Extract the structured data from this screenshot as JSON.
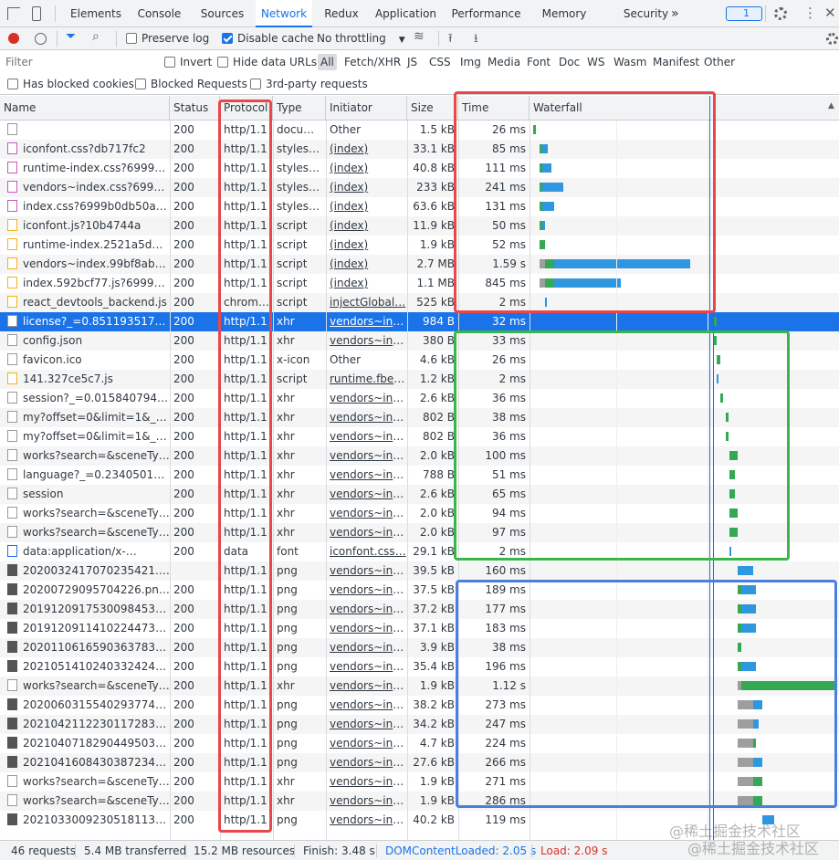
{
  "tabs": [
    "Elements",
    "Console",
    "Sources",
    "Network",
    "Redux",
    "Application",
    "Performance",
    "Memory",
    "Security"
  ],
  "tabs_more": "»",
  "issues_count": "1",
  "toolbar": {
    "preserve_log": "Preserve log",
    "disable_cache": "Disable cache",
    "throttling": "No throttling"
  },
  "filter": {
    "placeholder": "Filter",
    "invert": "Invert",
    "hide_data_urls": "Hide data URLs",
    "types": [
      "All",
      "Fetch/XHR",
      "JS",
      "CSS",
      "Img",
      "Media",
      "Font",
      "Doc",
      "WS",
      "Wasm",
      "Manifest",
      "Other"
    ]
  },
  "filter2": {
    "blocked_cookies": "Has blocked cookies",
    "blocked_requests": "Blocked Requests",
    "third_party": "3rd-party requests"
  },
  "columns": {
    "name": "Name",
    "status": "Status",
    "protocol": "Protocol",
    "type": "Type",
    "initiator": "Initiator",
    "size": "Size",
    "time": "Time",
    "waterfall": "Waterfall"
  },
  "colors": {
    "accent": "#1a73e8",
    "red_box": "#e8474b",
    "green_box": "#3ab54a",
    "blue_box": "#4a7fe0",
    "wf_blue": "#2f96e0",
    "wf_green": "#34a853",
    "wf_gray": "#9e9e9e"
  },
  "rows": [
    {
      "name": "",
      "icon": "doc",
      "status": "200",
      "protocol": "http/1.1",
      "type": "docu…",
      "initiator": "Other",
      "size": "1.5 kB",
      "time": "26 ms",
      "wf": [
        [
          0.0,
          0.01,
          "green"
        ]
      ]
    },
    {
      "name": "iconfont.css?db717fc2",
      "icon": "css",
      "status": "200",
      "protocol": "http/1.1",
      "type": "styles…",
      "initiator": "(index)",
      "size": "33.1 kB",
      "time": "85 ms",
      "wf": [
        [
          0.02,
          0.01,
          "green"
        ],
        [
          0.03,
          0.02,
          "blue"
        ]
      ]
    },
    {
      "name": "runtime-index.css?6999b0…",
      "icon": "css",
      "status": "200",
      "protocol": "http/1.1",
      "type": "styles…",
      "initiator": "(index)",
      "size": "40.8 kB",
      "time": "111 ms",
      "wf": [
        [
          0.02,
          0.01,
          "green"
        ],
        [
          0.03,
          0.03,
          "blue"
        ]
      ]
    },
    {
      "name": "vendors~index.css?6999b…",
      "icon": "css",
      "status": "200",
      "protocol": "http/1.1",
      "type": "styles…",
      "initiator": "(index)",
      "size": "233 kB",
      "time": "241 ms",
      "wf": [
        [
          0.02,
          0.01,
          "green"
        ],
        [
          0.03,
          0.07,
          "blue"
        ]
      ]
    },
    {
      "name": "index.css?6999b0db50a9…",
      "icon": "css",
      "status": "200",
      "protocol": "http/1.1",
      "type": "styles…",
      "initiator": "(index)",
      "size": "63.6 kB",
      "time": "131 ms",
      "wf": [
        [
          0.02,
          0.01,
          "green"
        ],
        [
          0.03,
          0.04,
          "blue"
        ]
      ]
    },
    {
      "name": "iconfont.js?10b4744a",
      "icon": "js",
      "status": "200",
      "protocol": "http/1.1",
      "type": "script",
      "initiator": "(index)",
      "size": "11.9 kB",
      "time": "50 ms",
      "wf": [
        [
          0.02,
          0.01,
          "green"
        ],
        [
          0.03,
          0.01,
          "blue"
        ]
      ]
    },
    {
      "name": "runtime-index.2521a5d8.js…",
      "icon": "js",
      "status": "200",
      "protocol": "http/1.1",
      "type": "script",
      "initiator": "(index)",
      "size": "1.9 kB",
      "time": "52 ms",
      "wf": [
        [
          0.02,
          0.02,
          "green"
        ]
      ]
    },
    {
      "name": "vendors~index.99bf8abe.j…",
      "icon": "js",
      "status": "200",
      "protocol": "http/1.1",
      "type": "script",
      "initiator": "(index)",
      "size": "2.7 MB",
      "time": "1.59 s",
      "wf": [
        [
          0.02,
          0.02,
          "gray"
        ],
        [
          0.04,
          0.03,
          "green"
        ],
        [
          0.07,
          0.45,
          "blue"
        ]
      ]
    },
    {
      "name": "index.592bcf77.js?6999b0…",
      "icon": "js",
      "status": "200",
      "protocol": "http/1.1",
      "type": "script",
      "initiator": "(index)",
      "size": "1.1 MB",
      "time": "845 ms",
      "wf": [
        [
          0.02,
          0.02,
          "gray"
        ],
        [
          0.04,
          0.03,
          "green"
        ],
        [
          0.07,
          0.22,
          "blue"
        ]
      ]
    },
    {
      "name": "react_devtools_backend.js",
      "icon": "js",
      "status": "200",
      "protocol": "chrom…",
      "type": "script",
      "initiator": "injectGlobal…",
      "size": "525 kB",
      "time": "2 ms",
      "wf": [
        [
          0.04,
          0.005,
          "blue"
        ]
      ]
    },
    {
      "name": "license?_=0.85119351779…",
      "icon": "doc",
      "status": "200",
      "protocol": "http/1.1",
      "type": "xhr",
      "initiator": "vendors~ind…",
      "size": "984 B",
      "time": "32 ms",
      "sel": true,
      "wf": [
        [
          0.6,
          0.01,
          "green"
        ]
      ]
    },
    {
      "name": "config.json",
      "icon": "doc",
      "status": "200",
      "protocol": "http/1.1",
      "type": "xhr",
      "initiator": "vendors~ind…",
      "size": "380 B",
      "time": "33 ms",
      "wf": [
        [
          0.6,
          0.01,
          "green"
        ]
      ]
    },
    {
      "name": "favicon.ico",
      "icon": "doc",
      "status": "200",
      "protocol": "http/1.1",
      "type": "x-icon",
      "initiator": "Other",
      "size": "4.6 kB",
      "time": "26 ms",
      "wf": [
        [
          0.61,
          0.01,
          "green"
        ]
      ]
    },
    {
      "name": "141.327ce5c7.js",
      "icon": "js",
      "status": "200",
      "protocol": "http/1.1",
      "type": "script",
      "initiator": "runtime.fbee…",
      "size": "1.2 kB",
      "time": "2 ms",
      "wf": [
        [
          0.61,
          0.005,
          "blue"
        ]
      ]
    },
    {
      "name": "session?_=0.0158407942…",
      "icon": "doc",
      "status": "200",
      "protocol": "http/1.1",
      "type": "xhr",
      "initiator": "vendors~ind…",
      "size": "2.6 kB",
      "time": "36 ms",
      "wf": [
        [
          0.62,
          0.01,
          "green"
        ]
      ]
    },
    {
      "name": "my?offset=0&limit=1&_=0.…",
      "icon": "doc",
      "status": "200",
      "protocol": "http/1.1",
      "type": "xhr",
      "initiator": "vendors~ind…",
      "size": "802 B",
      "time": "38 ms",
      "wf": [
        [
          0.64,
          0.01,
          "green"
        ]
      ]
    },
    {
      "name": "my?offset=0&limit=1&_=0.…",
      "icon": "doc",
      "status": "200",
      "protocol": "http/1.1",
      "type": "xhr",
      "initiator": "vendors~ind…",
      "size": "802 B",
      "time": "36 ms",
      "wf": [
        [
          0.64,
          0.01,
          "green"
        ]
      ]
    },
    {
      "name": "works?search=&sceneTyp…",
      "icon": "doc",
      "status": "200",
      "protocol": "http/1.1",
      "type": "xhr",
      "initiator": "vendors~ind…",
      "size": "2.0 kB",
      "time": "100 ms",
      "wf": [
        [
          0.65,
          0.03,
          "green"
        ]
      ]
    },
    {
      "name": "language?_=0.234050145…",
      "icon": "doc",
      "status": "200",
      "protocol": "http/1.1",
      "type": "xhr",
      "initiator": "vendors~ind…",
      "size": "788 B",
      "time": "51 ms",
      "wf": [
        [
          0.65,
          0.02,
          "green"
        ]
      ]
    },
    {
      "name": "session",
      "icon": "doc",
      "status": "200",
      "protocol": "http/1.1",
      "type": "xhr",
      "initiator": "vendors~ind…",
      "size": "2.6 kB",
      "time": "65 ms",
      "wf": [
        [
          0.65,
          0.02,
          "green"
        ]
      ]
    },
    {
      "name": "works?search=&sceneTyp…",
      "icon": "doc",
      "status": "200",
      "protocol": "http/1.1",
      "type": "xhr",
      "initiator": "vendors~ind…",
      "size": "2.0 kB",
      "time": "94 ms",
      "wf": [
        [
          0.65,
          0.03,
          "green"
        ]
      ]
    },
    {
      "name": "works?search=&sceneTyp…",
      "icon": "doc",
      "status": "200",
      "protocol": "http/1.1",
      "type": "xhr",
      "initiator": "vendors~ind…",
      "size": "2.0 kB",
      "time": "97 ms",
      "wf": [
        [
          0.65,
          0.03,
          "green"
        ]
      ]
    },
    {
      "name": "data:application/x-…",
      "icon": "data",
      "status": "200",
      "protocol": "data",
      "type": "font",
      "initiator": "iconfont.css…",
      "size": "29.1 kB",
      "time": "2 ms",
      "wf": [
        [
          0.65,
          0.005,
          "blue"
        ]
      ]
    },
    {
      "name": "20200324170702354​21.p…",
      "icon": "img",
      "status": "",
      "protocol": "http/1.1",
      "type": "png",
      "initiator": "vendors~ind…",
      "size": "39.5 kB",
      "time": "160 ms",
      "wf": [
        [
          0.68,
          0.05,
          "blue"
        ]
      ]
    },
    {
      "name": "20200729095704226​.pn…",
      "icon": "img",
      "status": "200",
      "protocol": "http/1.1",
      "type": "png",
      "initiator": "vendors~ind…",
      "size": "37.5 kB",
      "time": "189 ms",
      "wf": [
        [
          0.68,
          0.01,
          "green"
        ],
        [
          0.69,
          0.05,
          "blue"
        ]
      ]
    },
    {
      "name": "20191209175300984​532.…",
      "icon": "img",
      "status": "200",
      "protocol": "http/1.1",
      "type": "png",
      "initiator": "vendors~ind…",
      "size": "37.2 kB",
      "time": "177 ms",
      "wf": [
        [
          0.68,
          0.01,
          "green"
        ],
        [
          0.69,
          0.05,
          "blue"
        ]
      ]
    },
    {
      "name": "20191209114102244​738.…",
      "icon": "img",
      "status": "200",
      "protocol": "http/1.1",
      "type": "png",
      "initiator": "vendors~ind…",
      "size": "37.1 kB",
      "time": "183 ms",
      "wf": [
        [
          0.68,
          0.01,
          "green"
        ],
        [
          0.69,
          0.05,
          "blue"
        ]
      ]
    },
    {
      "name": "20201106165903637​838.…",
      "icon": "img",
      "status": "200",
      "protocol": "http/1.1",
      "type": "png",
      "initiator": "vendors~ind…",
      "size": "3.9 kB",
      "time": "38 ms",
      "wf": [
        [
          0.68,
          0.01,
          "green"
        ]
      ]
    },
    {
      "name": "20210514102403324​2483.…",
      "icon": "img",
      "status": "200",
      "protocol": "http/1.1",
      "type": "png",
      "initiator": "vendors~ind…",
      "size": "35.4 kB",
      "time": "196 ms",
      "wf": [
        [
          0.68,
          0.01,
          "green"
        ],
        [
          0.69,
          0.05,
          "blue"
        ]
      ]
    },
    {
      "name": "works?search=&sceneTyp…",
      "icon": "doc",
      "status": "200",
      "protocol": "http/1.1",
      "type": "xhr",
      "initiator": "vendors~ind…",
      "size": "1.9 kB",
      "time": "1.12 s",
      "wf": [
        [
          0.68,
          0.01,
          "gray"
        ],
        [
          0.69,
          0.31,
          "green"
        ]
      ]
    },
    {
      "name": "20200603155402937​743.…",
      "icon": "img",
      "status": "200",
      "protocol": "http/1.1",
      "type": "png",
      "initiator": "vendors~ind…",
      "size": "38.2 kB",
      "time": "273 ms",
      "wf": [
        [
          0.68,
          0.05,
          "gray"
        ],
        [
          0.73,
          0.03,
          "blue"
        ]
      ]
    },
    {
      "name": "20210421122301172​8329.…",
      "icon": "img",
      "status": "200",
      "protocol": "http/1.1",
      "type": "png",
      "initiator": "vendors~ind…",
      "size": "34.2 kB",
      "time": "247 ms",
      "wf": [
        [
          0.68,
          0.05,
          "gray"
        ],
        [
          0.73,
          0.02,
          "blue"
        ]
      ]
    },
    {
      "name": "20210407182904495​039.…",
      "icon": "img",
      "status": "200",
      "protocol": "http/1.1",
      "type": "png",
      "initiator": "vendors~ind…",
      "size": "4.7 kB",
      "time": "224 ms",
      "wf": [
        [
          0.68,
          0.05,
          "gray"
        ],
        [
          0.73,
          0.01,
          "green"
        ]
      ]
    },
    {
      "name": "20210416084303872​3430.…",
      "icon": "img",
      "status": "200",
      "protocol": "http/1.1",
      "type": "png",
      "initiator": "vendors~ind…",
      "size": "27.6 kB",
      "time": "266 ms",
      "wf": [
        [
          0.68,
          0.05,
          "gray"
        ],
        [
          0.73,
          0.03,
          "blue"
        ]
      ]
    },
    {
      "name": "works?search=&sceneTyp…",
      "icon": "doc",
      "status": "200",
      "protocol": "http/1.1",
      "type": "xhr",
      "initiator": "vendors~ind…",
      "size": "1.9 kB",
      "time": "271 ms",
      "wf": [
        [
          0.68,
          0.05,
          "gray"
        ],
        [
          0.73,
          0.03,
          "green"
        ]
      ]
    },
    {
      "name": "works?search=&sceneTyp…",
      "icon": "doc",
      "status": "200",
      "protocol": "http/1.1",
      "type": "xhr",
      "initiator": "vendors~ind…",
      "size": "1.9 kB",
      "time": "286 ms",
      "wf": [
        [
          0.68,
          0.05,
          "gray"
        ],
        [
          0.73,
          0.03,
          "green"
        ]
      ]
    },
    {
      "name": "20210330092305181​1329.…",
      "icon": "img",
      "status": "200",
      "protocol": "http/1.1",
      "type": "png",
      "initiator": "vendors~ind…",
      "size": "40.2 kB",
      "time": "119 ms",
      "wf": [
        [
          0.76,
          0.04,
          "blue"
        ]
      ]
    }
  ],
  "status": {
    "requests": "46 requests",
    "transferred": "5.4 MB transferred",
    "resources": "15.2 MB resources",
    "finish": "Finish: 3.48 s",
    "dcl": "DOMContentLoaded: 2.05 s",
    "load": "Load: 2.09 s"
  },
  "watermark": "@稀土掘金技术社区"
}
